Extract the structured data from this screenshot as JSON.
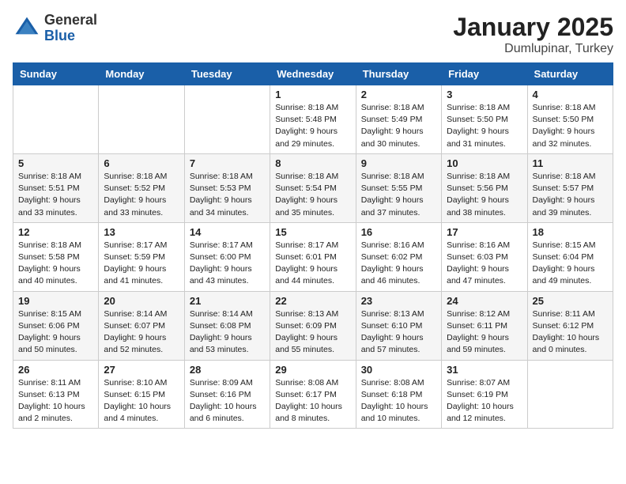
{
  "logo": {
    "general": "General",
    "blue": "Blue"
  },
  "header": {
    "title": "January 2025",
    "location": "Dumlupinar, Turkey"
  },
  "weekdays": [
    "Sunday",
    "Monday",
    "Tuesday",
    "Wednesday",
    "Thursday",
    "Friday",
    "Saturday"
  ],
  "rows": [
    {
      "cells": [
        {
          "day": "",
          "info": ""
        },
        {
          "day": "",
          "info": ""
        },
        {
          "day": "",
          "info": ""
        },
        {
          "day": "1",
          "info": "Sunrise: 8:18 AM\nSunset: 5:48 PM\nDaylight: 9 hours\nand 29 minutes."
        },
        {
          "day": "2",
          "info": "Sunrise: 8:18 AM\nSunset: 5:49 PM\nDaylight: 9 hours\nand 30 minutes."
        },
        {
          "day": "3",
          "info": "Sunrise: 8:18 AM\nSunset: 5:50 PM\nDaylight: 9 hours\nand 31 minutes."
        },
        {
          "day": "4",
          "info": "Sunrise: 8:18 AM\nSunset: 5:50 PM\nDaylight: 9 hours\nand 32 minutes."
        }
      ],
      "shade": false
    },
    {
      "cells": [
        {
          "day": "5",
          "info": "Sunrise: 8:18 AM\nSunset: 5:51 PM\nDaylight: 9 hours\nand 33 minutes."
        },
        {
          "day": "6",
          "info": "Sunrise: 8:18 AM\nSunset: 5:52 PM\nDaylight: 9 hours\nand 33 minutes."
        },
        {
          "day": "7",
          "info": "Sunrise: 8:18 AM\nSunset: 5:53 PM\nDaylight: 9 hours\nand 34 minutes."
        },
        {
          "day": "8",
          "info": "Sunrise: 8:18 AM\nSunset: 5:54 PM\nDaylight: 9 hours\nand 35 minutes."
        },
        {
          "day": "9",
          "info": "Sunrise: 8:18 AM\nSunset: 5:55 PM\nDaylight: 9 hours\nand 37 minutes."
        },
        {
          "day": "10",
          "info": "Sunrise: 8:18 AM\nSunset: 5:56 PM\nDaylight: 9 hours\nand 38 minutes."
        },
        {
          "day": "11",
          "info": "Sunrise: 8:18 AM\nSunset: 5:57 PM\nDaylight: 9 hours\nand 39 minutes."
        }
      ],
      "shade": true
    },
    {
      "cells": [
        {
          "day": "12",
          "info": "Sunrise: 8:18 AM\nSunset: 5:58 PM\nDaylight: 9 hours\nand 40 minutes."
        },
        {
          "day": "13",
          "info": "Sunrise: 8:17 AM\nSunset: 5:59 PM\nDaylight: 9 hours\nand 41 minutes."
        },
        {
          "day": "14",
          "info": "Sunrise: 8:17 AM\nSunset: 6:00 PM\nDaylight: 9 hours\nand 43 minutes."
        },
        {
          "day": "15",
          "info": "Sunrise: 8:17 AM\nSunset: 6:01 PM\nDaylight: 9 hours\nand 44 minutes."
        },
        {
          "day": "16",
          "info": "Sunrise: 8:16 AM\nSunset: 6:02 PM\nDaylight: 9 hours\nand 46 minutes."
        },
        {
          "day": "17",
          "info": "Sunrise: 8:16 AM\nSunset: 6:03 PM\nDaylight: 9 hours\nand 47 minutes."
        },
        {
          "day": "18",
          "info": "Sunrise: 8:15 AM\nSunset: 6:04 PM\nDaylight: 9 hours\nand 49 minutes."
        }
      ],
      "shade": false
    },
    {
      "cells": [
        {
          "day": "19",
          "info": "Sunrise: 8:15 AM\nSunset: 6:06 PM\nDaylight: 9 hours\nand 50 minutes."
        },
        {
          "day": "20",
          "info": "Sunrise: 8:14 AM\nSunset: 6:07 PM\nDaylight: 9 hours\nand 52 minutes."
        },
        {
          "day": "21",
          "info": "Sunrise: 8:14 AM\nSunset: 6:08 PM\nDaylight: 9 hours\nand 53 minutes."
        },
        {
          "day": "22",
          "info": "Sunrise: 8:13 AM\nSunset: 6:09 PM\nDaylight: 9 hours\nand 55 minutes."
        },
        {
          "day": "23",
          "info": "Sunrise: 8:13 AM\nSunset: 6:10 PM\nDaylight: 9 hours\nand 57 minutes."
        },
        {
          "day": "24",
          "info": "Sunrise: 8:12 AM\nSunset: 6:11 PM\nDaylight: 9 hours\nand 59 minutes."
        },
        {
          "day": "25",
          "info": "Sunrise: 8:11 AM\nSunset: 6:12 PM\nDaylight: 10 hours\nand 0 minutes."
        }
      ],
      "shade": true
    },
    {
      "cells": [
        {
          "day": "26",
          "info": "Sunrise: 8:11 AM\nSunset: 6:13 PM\nDaylight: 10 hours\nand 2 minutes."
        },
        {
          "day": "27",
          "info": "Sunrise: 8:10 AM\nSunset: 6:15 PM\nDaylight: 10 hours\nand 4 minutes."
        },
        {
          "day": "28",
          "info": "Sunrise: 8:09 AM\nSunset: 6:16 PM\nDaylight: 10 hours\nand 6 minutes."
        },
        {
          "day": "29",
          "info": "Sunrise: 8:08 AM\nSunset: 6:17 PM\nDaylight: 10 hours\nand 8 minutes."
        },
        {
          "day": "30",
          "info": "Sunrise: 8:08 AM\nSunset: 6:18 PM\nDaylight: 10 hours\nand 10 minutes."
        },
        {
          "day": "31",
          "info": "Sunrise: 8:07 AM\nSunset: 6:19 PM\nDaylight: 10 hours\nand 12 minutes."
        },
        {
          "day": "",
          "info": ""
        }
      ],
      "shade": false
    }
  ]
}
